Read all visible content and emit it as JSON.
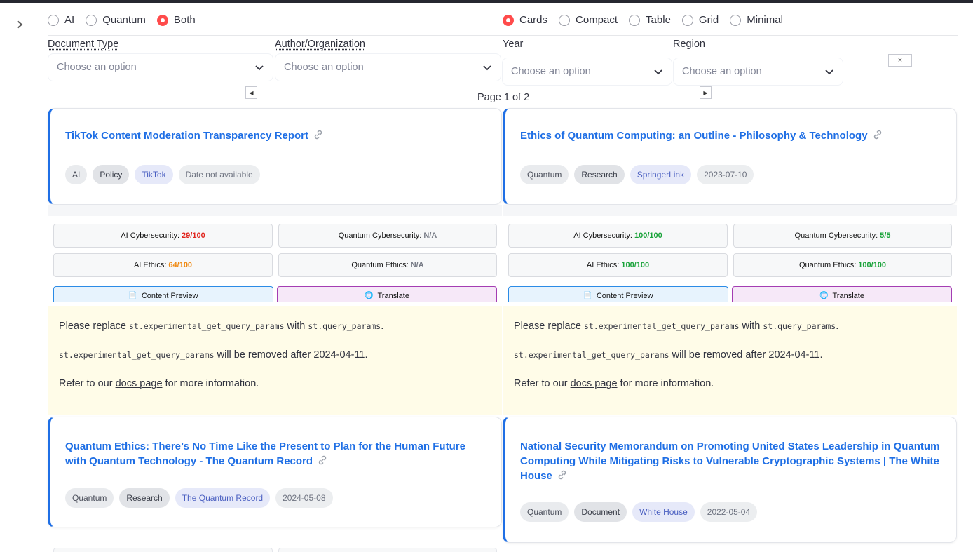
{
  "colors": {
    "accent": "#ff4b4b",
    "link": "#1f6fe5",
    "warning_bg": "#fffce8"
  },
  "domain_radio": {
    "options": [
      "AI",
      "Quantum",
      "Both"
    ],
    "selected": "Both"
  },
  "view_radio": {
    "options": [
      "Cards",
      "Compact",
      "Table",
      "Grid",
      "Minimal"
    ],
    "selected": "Cards"
  },
  "filters": {
    "document_type": {
      "label": "Document Type",
      "placeholder": "Choose an option"
    },
    "author_org": {
      "label": "Author/Organization",
      "placeholder": "Choose an option"
    },
    "year": {
      "label": "Year",
      "placeholder": "Choose an option"
    },
    "region": {
      "label": "Region",
      "placeholder": "Choose an option"
    },
    "clear_label": "×"
  },
  "pagination": {
    "prev": "◀",
    "next": "▶",
    "label": "Page 1 of 2"
  },
  "cards": [
    {
      "title": "TikTok Content Moderation Transparency Report",
      "tags": [
        "AI",
        "Policy",
        "TikTok",
        "Date not available"
      ],
      "metrics": [
        {
          "label": "AI Cybersecurity:",
          "value": "29/100",
          "color": "red"
        },
        {
          "label": "Quantum Cybersecurity:",
          "value": "N/A",
          "color": "gray"
        },
        {
          "label": "AI Ethics:",
          "value": "64/100",
          "color": "orange"
        },
        {
          "label": "Quantum Ethics:",
          "value": "N/A",
          "color": "gray"
        }
      ],
      "tabs": [
        "Content Preview",
        "Translate"
      ]
    },
    {
      "title": "Ethics of Quantum Computing: an Outline - Philosophy & Technology",
      "tags": [
        "Quantum",
        "Research",
        "SpringerLink",
        "2023-07-10"
      ],
      "metrics": [
        {
          "label": "AI Cybersecurity:",
          "value": "100/100",
          "color": "green"
        },
        {
          "label": "Quantum Cybersecurity:",
          "value": "5/5",
          "color": "green"
        },
        {
          "label": "AI Ethics:",
          "value": "100/100",
          "color": "green"
        },
        {
          "label": "Quantum Ethics:",
          "value": "100/100",
          "color": "green"
        }
      ],
      "tabs": [
        "Content Preview",
        "Translate"
      ]
    },
    {
      "title": "Quantum Ethics: There’s No Time Like the Present to Plan for the Human Future with Quantum Technology - The Quantum Record",
      "tags": [
        "Quantum",
        "Research",
        "The Quantum Record",
        "2024-05-08"
      ]
    },
    {
      "title": "National Security Memorandum on Promoting United States Leadership in Quantum Computing While Mitigating Risks to Vulnerable Cryptographic Systems | The White House",
      "tags": [
        "Quantum",
        "Document",
        "White House",
        "2022-05-04"
      ]
    }
  ],
  "warning": {
    "line1_pre": "Please replace ",
    "line1_code1": "st.experimental_get_query_params",
    "line1_mid": " with ",
    "line1_code2": "st.query_params",
    "line1_post": ".",
    "line2_code": "st.experimental_get_query_params",
    "line2_post": " will be removed after 2024-04-11.",
    "line3_pre": "Refer to our ",
    "line3_link": "docs page",
    "line3_post": " for more information."
  },
  "icons": {
    "sidebar": "chevron-right-icon",
    "link": "link-icon",
    "preview": "page-icon",
    "translate": "globe-icon"
  }
}
